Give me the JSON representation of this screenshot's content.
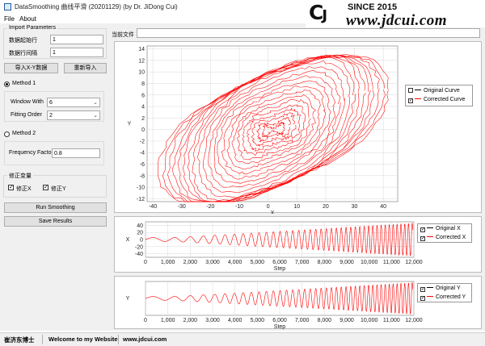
{
  "window": {
    "title": "DataSmoothing 曲线平滑 (20201129) (by Dr. JiDong Cui)"
  },
  "logo": {
    "since": "SINCE 2015",
    "url": "www.jdcui.com"
  },
  "menu": [
    "File",
    "About"
  ],
  "import_params": {
    "title": "Import Parameters",
    "start_row_label": "数据起始行",
    "start_row_value": "1",
    "row_interval_label": "数据行间隔",
    "row_interval_value": "1"
  },
  "buttons": {
    "import_xy": "导入X-Y数据",
    "reimport": "重新导入",
    "run": "Run Smoothing",
    "save": "Save Results"
  },
  "method1": {
    "label": "Method 1",
    "window_label": "Window With",
    "window_value": "6",
    "order_label": "Fitting Order",
    "order_value": "2"
  },
  "method2": {
    "label": "Method 2",
    "freq_label": "Frequency Factor",
    "freq_value": "0.8"
  },
  "correction": {
    "title": "修正变量",
    "x_label": "修正X",
    "y_label": "修正Y"
  },
  "current_file": {
    "label": "当前文件",
    "value": ""
  },
  "status": {
    "author": "崔济东博士",
    "welcome": "Welcome to my Website",
    "site": "www.jdcui.com"
  },
  "colors": {
    "corrected": "#ff0000",
    "original": "#000000",
    "grid": "#d8d8d8"
  },
  "chart_data": [
    {
      "type": "line",
      "name": "hysteresis",
      "xlabel": "X",
      "ylabel": "Y",
      "xlim": [
        -42,
        45
      ],
      "ylim": [
        -12.5,
        14.5
      ],
      "xticks": [
        -40,
        -30,
        -20,
        -10,
        0,
        10,
        20,
        30,
        40
      ],
      "yticks": [
        -12,
        -10,
        -8,
        -6,
        -4,
        -2,
        0,
        2,
        4,
        6,
        8,
        10,
        12,
        14
      ],
      "legend": [
        "Original Curve",
        "Corrected Curve"
      ],
      "legend_checked": [
        false,
        true
      ],
      "grid": true
    },
    {
      "type": "line",
      "name": "x-vs-step",
      "xlabel": "Step",
      "ylabel": "X",
      "xlim": [
        0,
        12000
      ],
      "ylim": [
        -50,
        50
      ],
      "xticks": [
        0,
        1000,
        2000,
        3000,
        4000,
        5000,
        6000,
        7000,
        8000,
        9000,
        10000,
        11000,
        12000
      ],
      "xtick_labels": [
        "0",
        "1,000",
        "2,000",
        "3,000",
        "4,000",
        "5,000",
        "6,000",
        "7,000",
        "8,000",
        "9,000",
        "10,000",
        "11,000",
        "12,000"
      ],
      "yticks": [
        -40,
        -20,
        0,
        20,
        40
      ],
      "legend": [
        "Original X",
        "Corrected X"
      ],
      "legend_checked": [
        true,
        true
      ],
      "grid": true
    },
    {
      "type": "line",
      "name": "y-vs-step",
      "xlabel": "Step",
      "ylabel": "Y",
      "xlim": [
        0,
        12000
      ],
      "ylim": [
        -14,
        14
      ],
      "xticks": [
        0,
        1000,
        2000,
        3000,
        4000,
        5000,
        6000,
        7000,
        8000,
        9000,
        10000,
        11000,
        12000
      ],
      "xtick_labels": [
        "0",
        "1,000",
        "2,000",
        "3,000",
        "4,000",
        "5,000",
        "6,000",
        "7,000",
        "8,000",
        "9,000",
        "10,000",
        "11,000",
        "12,000"
      ],
      "yticks": [],
      "legend": [
        "Original Y",
        "Corrected Y"
      ],
      "legend_checked": [
        true,
        true
      ],
      "grid": true
    }
  ]
}
